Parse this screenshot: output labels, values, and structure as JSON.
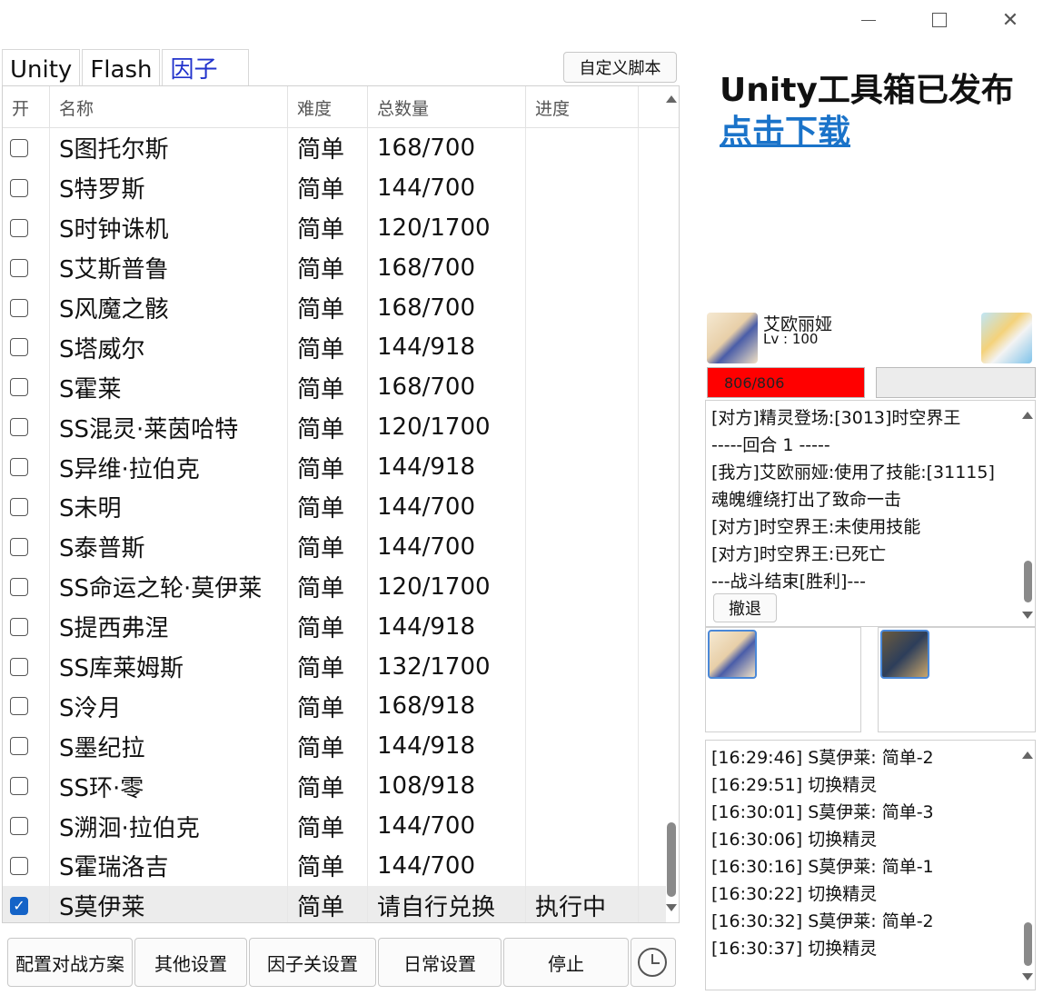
{
  "window": {
    "minimize": "—",
    "maximize": "☐",
    "close": "✕"
  },
  "tabs": [
    {
      "label": "Unity"
    },
    {
      "label": "Flash"
    },
    {
      "label": "因子"
    }
  ],
  "toolbar": {
    "custom_script_label": "自定义脚本"
  },
  "table": {
    "headers": [
      "开",
      "名称",
      "难度",
      "总数量",
      "进度"
    ],
    "rows": [
      {
        "checked": false,
        "name": "S图托尔斯",
        "difficulty": "简单",
        "total": "168/700",
        "progress": ""
      },
      {
        "checked": false,
        "name": "S特罗斯",
        "difficulty": "简单",
        "total": "144/700",
        "progress": ""
      },
      {
        "checked": false,
        "name": "S时钟诛机",
        "difficulty": "简单",
        "total": "120/1700",
        "progress": ""
      },
      {
        "checked": false,
        "name": "S艾斯普鲁",
        "difficulty": "简单",
        "total": "168/700",
        "progress": ""
      },
      {
        "checked": false,
        "name": "S风魔之骸",
        "difficulty": "简单",
        "total": "168/700",
        "progress": ""
      },
      {
        "checked": false,
        "name": "S塔威尔",
        "difficulty": "简单",
        "total": "144/918",
        "progress": ""
      },
      {
        "checked": false,
        "name": "S霍莱",
        "difficulty": "简单",
        "total": "168/700",
        "progress": ""
      },
      {
        "checked": false,
        "name": "SS混灵·莱茵哈特",
        "difficulty": "简单",
        "total": "120/1700",
        "progress": ""
      },
      {
        "checked": false,
        "name": "S异维·拉伯克",
        "difficulty": "简单",
        "total": "144/918",
        "progress": ""
      },
      {
        "checked": false,
        "name": "S未明",
        "difficulty": "简单",
        "total": "144/700",
        "progress": ""
      },
      {
        "checked": false,
        "name": "S泰普斯",
        "difficulty": "简单",
        "total": "144/700",
        "progress": ""
      },
      {
        "checked": false,
        "name": "SS命运之轮·莫伊莱",
        "difficulty": "简单",
        "total": "120/1700",
        "progress": ""
      },
      {
        "checked": false,
        "name": "S提西弗涅",
        "difficulty": "简单",
        "total": "144/918",
        "progress": ""
      },
      {
        "checked": false,
        "name": "SS库莱姆斯",
        "difficulty": "简单",
        "total": "132/1700",
        "progress": ""
      },
      {
        "checked": false,
        "name": "S泠月",
        "difficulty": "简单",
        "total": "168/918",
        "progress": ""
      },
      {
        "checked": false,
        "name": "S墨纪拉",
        "difficulty": "简单",
        "total": "144/918",
        "progress": ""
      },
      {
        "checked": false,
        "name": "SS环·零",
        "difficulty": "简单",
        "total": "108/918",
        "progress": ""
      },
      {
        "checked": false,
        "name": "S溯洄·拉伯克",
        "difficulty": "简单",
        "total": "144/700",
        "progress": ""
      },
      {
        "checked": false,
        "name": "S霍瑞洛吉",
        "difficulty": "简单",
        "total": "144/700",
        "progress": ""
      },
      {
        "checked": true,
        "name": "S莫伊莱",
        "difficulty": "简单",
        "total": "请自行兑换",
        "progress": "执行中"
      }
    ]
  },
  "buttons": {
    "battle_plan": "配置对战方案",
    "other_settings": "其他设置",
    "factor_settings": "因子关设置",
    "daily_settings": "日常设置",
    "stop": "停止"
  },
  "promo": {
    "title": "Unity工具箱已发布",
    "link": "点击下载"
  },
  "battle": {
    "pet_name": "艾欧丽娅",
    "pet_level": "Lv : 100",
    "hp": "806/806",
    "log": [
      "[对方]精灵登场:[3013]时空界王",
      "-----回合 1 -----",
      "[我方]艾欧丽娅:使用了技能:[31115]",
      "魂魄缠绕打出了致命一击",
      "[对方]时空界王:未使用技能",
      "[对方]时空界王:已死亡",
      "---战斗结束[胜利]---"
    ],
    "retreat_label": "撤退"
  },
  "events": [
    "[16:29:46] S莫伊莱: 简单-2",
    "[16:29:51] 切换精灵",
    "[16:30:01] S莫伊莱: 简单-3",
    "[16:30:06] 切换精灵",
    "[16:30:16] S莫伊莱: 简单-1",
    "[16:30:22] 切换精灵",
    "[16:30:32] S莫伊莱: 简单-2",
    "[16:30:37] 切换精灵"
  ]
}
